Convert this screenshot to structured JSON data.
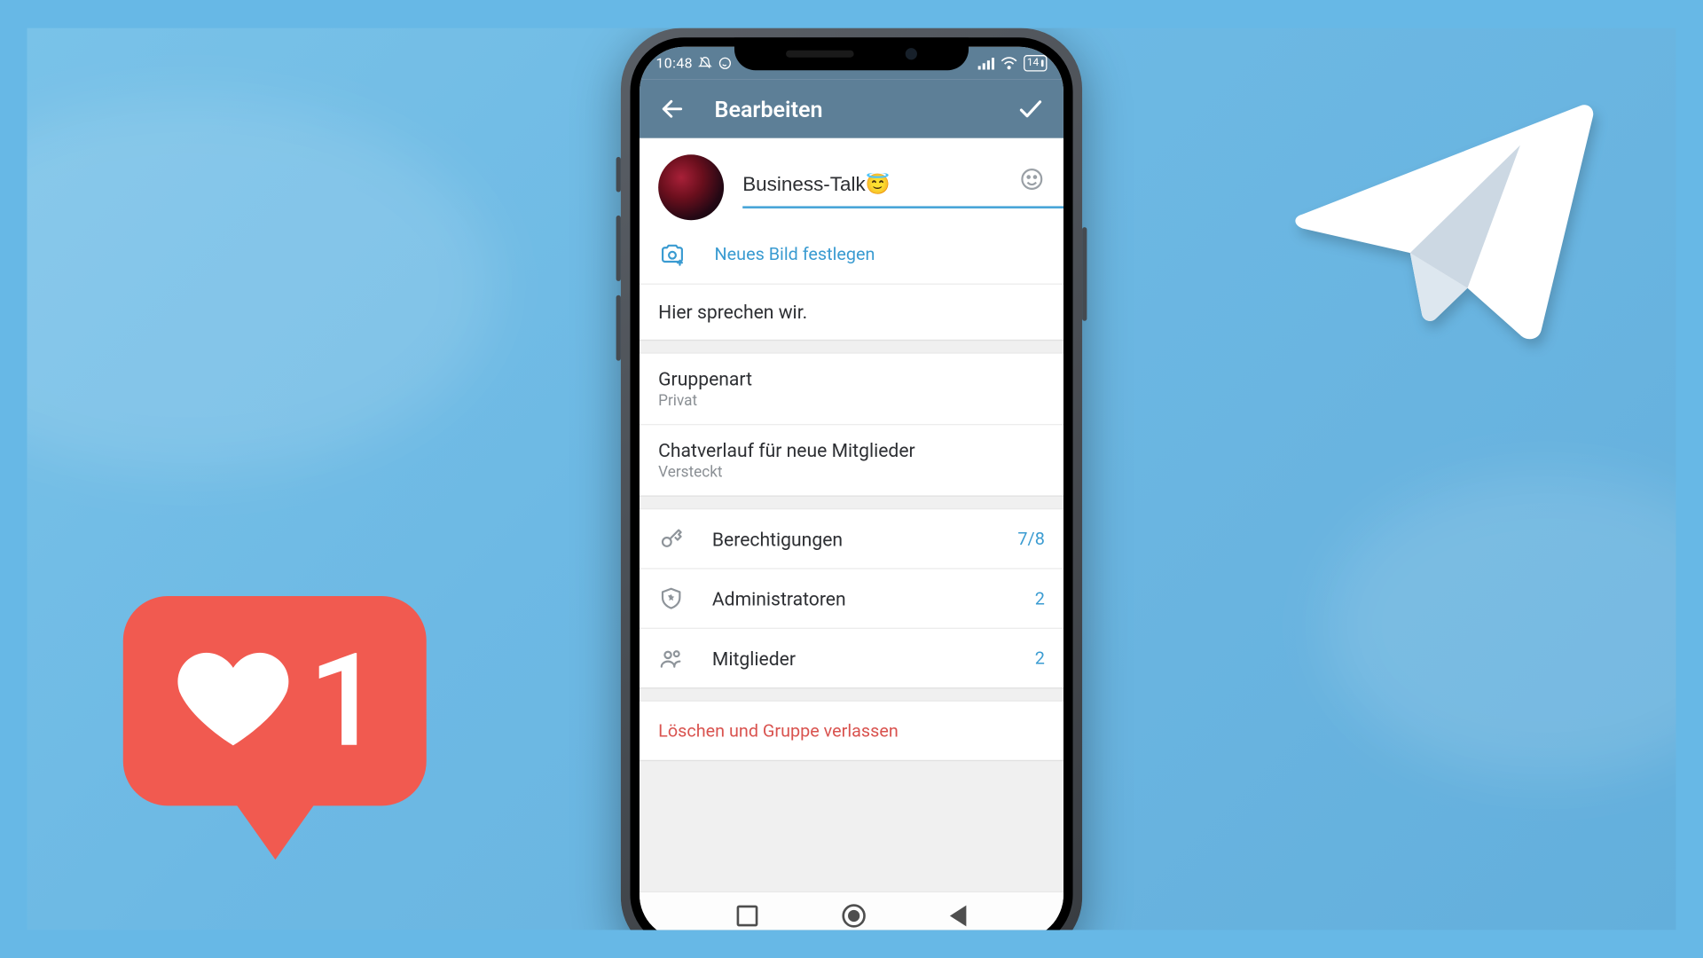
{
  "statusbar": {
    "time": "10:48",
    "battery": "14"
  },
  "header": {
    "title": "Bearbeiten"
  },
  "group": {
    "name": "Business-Talk😇",
    "set_image": "Neues Bild festlegen",
    "description": "Hier sprechen wir."
  },
  "settings": {
    "type": {
      "label": "Gruppenart",
      "value": "Privat"
    },
    "history": {
      "label": "Chatverlauf für neue Mitglieder",
      "value": "Versteckt"
    }
  },
  "management": {
    "permissions": {
      "label": "Berechtigungen",
      "value": "7/8"
    },
    "admins": {
      "label": "Administratoren",
      "value": "2"
    },
    "members": {
      "label": "Mitglieder",
      "value": "2"
    }
  },
  "danger": {
    "delete": "Löschen und Gruppe verlassen"
  },
  "overlay": {
    "like_count": "1"
  }
}
